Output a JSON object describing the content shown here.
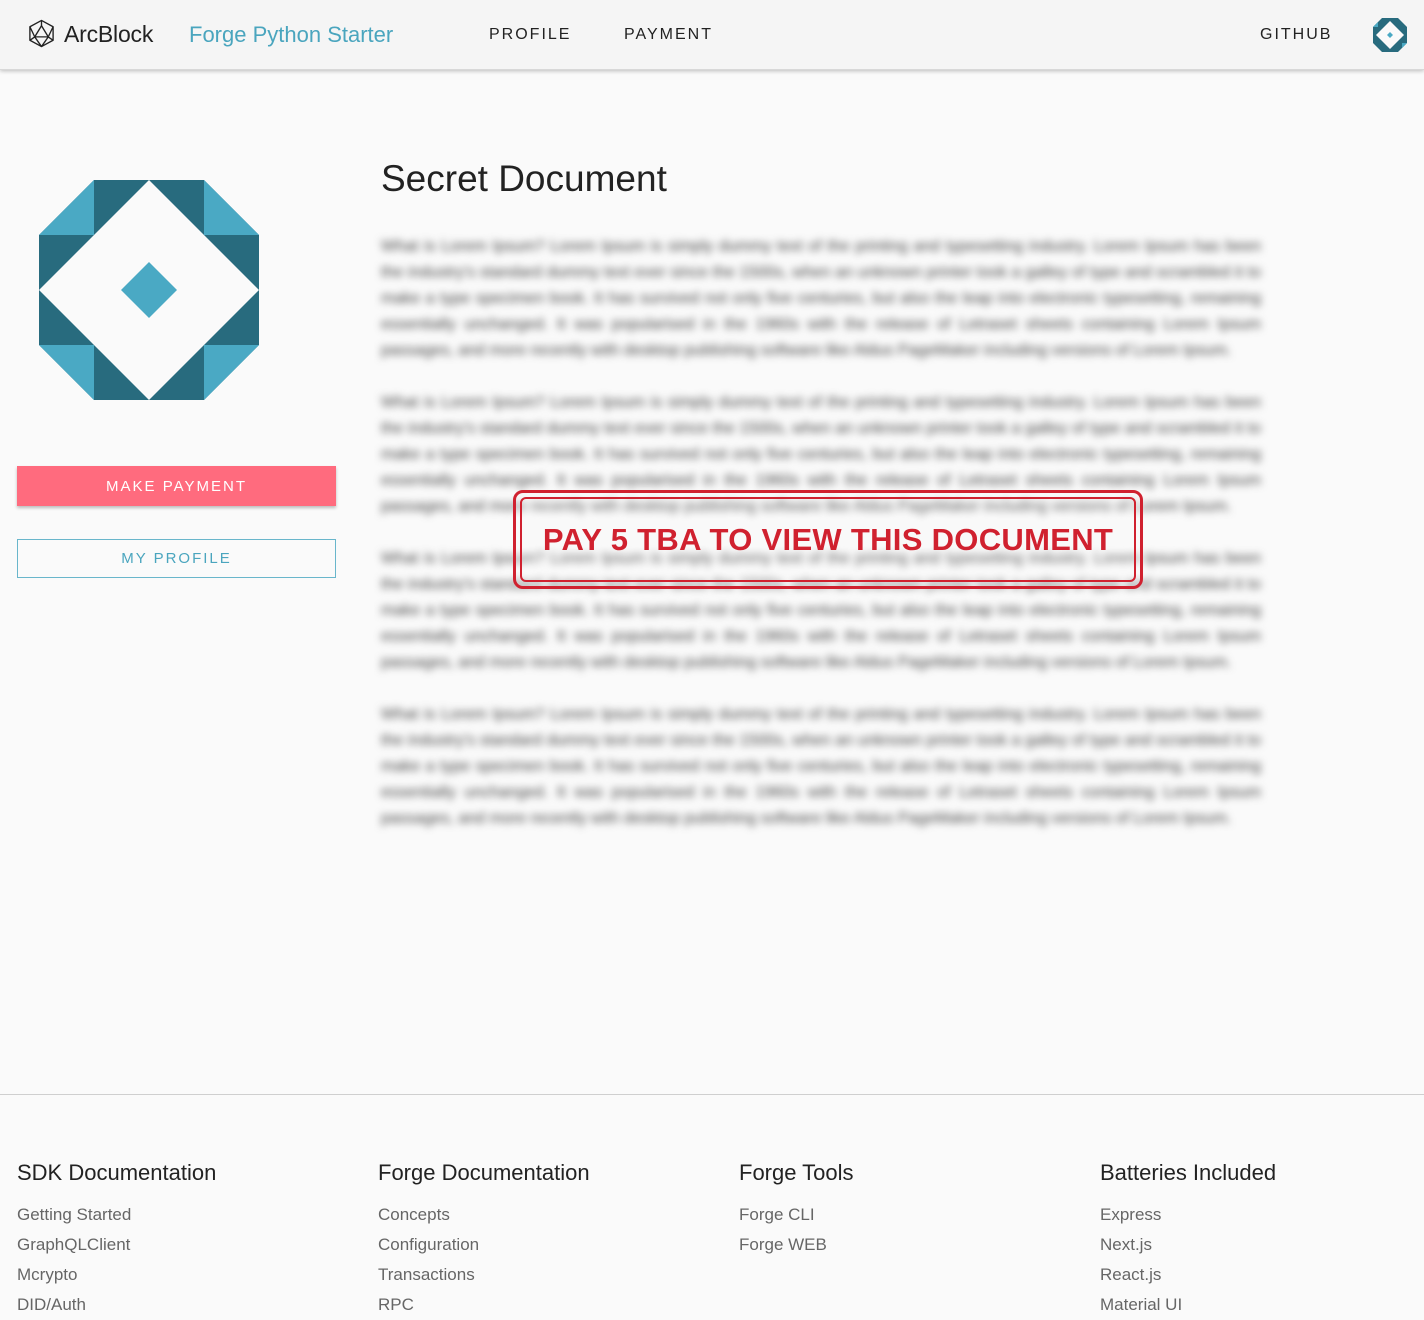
{
  "header": {
    "brand": "ArcBlock",
    "app_title": "Forge Python Starter",
    "nav": {
      "profile": "PROFILE",
      "payment": "PAYMENT",
      "github": "GITHUB"
    }
  },
  "sidebar": {
    "make_payment": "MAKE PAYMENT",
    "my_profile": "MY PROFILE"
  },
  "document": {
    "title": "Secret Document",
    "paragraphs": [
      "What is Lorem Ipsum? Lorem Ipsum is simply dummy text of the printing and typesetting industry. Lorem Ipsum has been the industry's standard dummy text ever since the 1500s, when an unknown printer took a galley of type and scrambled it to make a type specimen book. It has survived not only five centuries, but also the leap into electronic typesetting, remaining essentially unchanged. It was popularised in the 1960s with the release of Letraset sheets containing Lorem Ipsum passages, and more recently with desktop publishing software like Aldus PageMaker including versions of Lorem Ipsum.",
      "What is Lorem Ipsum? Lorem Ipsum is simply dummy text of the printing and typesetting industry. Lorem Ipsum has been the industry's standard dummy text ever since the 1500s, when an unknown printer took a galley of type and scrambled it to make a type specimen book. It has survived not only five centuries, but also the leap into electronic typesetting, remaining essentially unchanged. It was popularised in the 1960s with the release of Letraset sheets containing Lorem Ipsum passages, and more recently with desktop publishing software like Aldus PageMaker including versions of Lorem Ipsum.",
      "What is Lorem Ipsum? Lorem Ipsum is simply dummy text of the printing and typesetting industry. Lorem Ipsum has been the industry's standard dummy text ever since the 1500s, when an unknown printer took a galley of type and scrambled it to make a type specimen book. It has survived not only five centuries, but also the leap into electronic typesetting, remaining essentially unchanged. It was popularised in the 1960s with the release of Letraset sheets containing Lorem Ipsum passages, and more recently with desktop publishing software like Aldus PageMaker including versions of Lorem Ipsum.",
      "What is Lorem Ipsum? Lorem Ipsum is simply dummy text of the printing and typesetting industry. Lorem Ipsum has been the industry's standard dummy text ever since the 1500s, when an unknown printer took a galley of type and scrambled it to make a type specimen book. It has survived not only five centuries, but also the leap into electronic typesetting, remaining essentially unchanged. It was popularised in the 1960s with the release of Letraset sheets containing Lorem Ipsum passages, and more recently with desktop publishing software like Aldus PageMaker including versions of Lorem Ipsum."
    ],
    "stamp": "PAY 5 TBA TO VIEW THIS DOCUMENT"
  },
  "footer": {
    "columns": [
      {
        "title": "SDK Documentation",
        "links": [
          "Getting Started",
          "GraphQLClient",
          "Mcrypto",
          "DID/Auth"
        ]
      },
      {
        "title": "Forge Documentation",
        "links": [
          "Concepts",
          "Configuration",
          "Transactions",
          "RPC"
        ]
      },
      {
        "title": "Forge Tools",
        "links": [
          "Forge CLI",
          "Forge WEB"
        ]
      },
      {
        "title": "Batteries Included",
        "links": [
          "Express",
          "Next.js",
          "React.js",
          "Material UI"
        ]
      }
    ]
  },
  "colors": {
    "accent": "#4aa5be",
    "pay_button": "#ff6b7e",
    "stamp": "#d0212f",
    "avatar_dark": "#286b7e",
    "avatar_light": "#4aa9c4"
  },
  "icons": {
    "logo": "arcblock-logo-icon",
    "avatar": "identicon-avatar-icon"
  }
}
